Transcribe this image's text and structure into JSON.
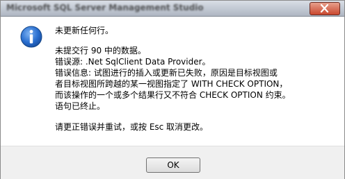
{
  "window": {
    "title": "Microsoft SQL Server Management Studio"
  },
  "message": {
    "heading": "未更新任何行。",
    "lines": [
      "未提交行 90 中的数据。",
      "错误源: .Net SqlClient Data Provider。",
      "错误信息: 试图进行的插入或更新已失败，原因是目标视图或",
      "者目标视图所跨越的某一视图指定了 WITH CHECK OPTION，",
      "而该操作的一个或多个结果行又不符合 CHECK OPTION 约束。",
      "语句已终止。"
    ],
    "instruction": "请更正错误并重试，或按 Esc 取消更改。"
  },
  "buttons": {
    "ok_label": "OK"
  },
  "colors": {
    "icon_blue": "#2a6fd0",
    "close_red": "#c9482f"
  },
  "icons": {
    "info": "info-icon",
    "close": "close-icon"
  }
}
